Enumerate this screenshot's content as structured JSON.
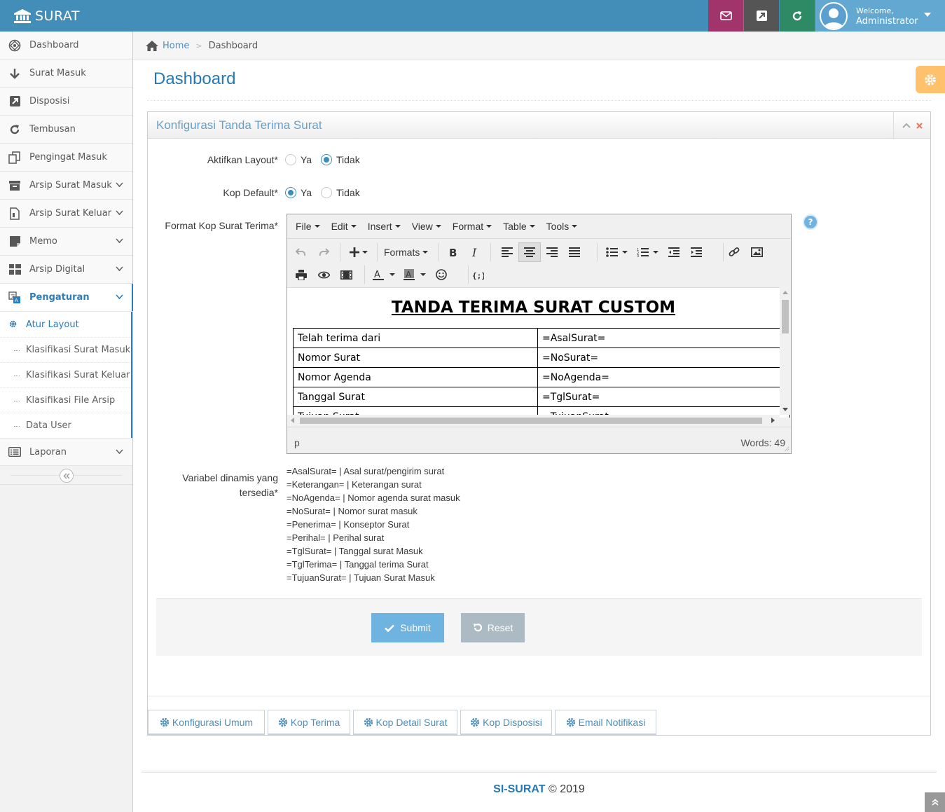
{
  "app": {
    "title": "SURAT"
  },
  "header": {
    "welcome_label": "Welcome,",
    "username": "Administrator",
    "colors": {
      "bar": "#438eb9",
      "mail": "#a0346b",
      "edit": "#555555",
      "refresh": "#2e8965",
      "user": "#62a8d1"
    }
  },
  "sidebar": {
    "items": [
      {
        "label": "Dashboard",
        "icon": "dashboard-icon"
      },
      {
        "label": "Surat Masuk",
        "icon": "arrow-down-icon"
      },
      {
        "label": "Disposisi",
        "icon": "share-icon"
      },
      {
        "label": "Tembusan",
        "icon": "refresh-icon"
      },
      {
        "label": "Pengingat Masuk",
        "icon": "copy-icon"
      },
      {
        "label": "Arsip Surat Masuk",
        "icon": "archive-icon"
      },
      {
        "label": "Arsip Surat Keluar",
        "icon": "file-icon"
      },
      {
        "label": "Memo",
        "icon": "sticky-note-icon"
      },
      {
        "label": "Arsip Digital",
        "icon": "grid-icon"
      },
      {
        "label": "Pengaturan",
        "icon": "language-icon"
      },
      {
        "label": "Laporan",
        "icon": "list-alt-icon"
      }
    ],
    "submenu": [
      {
        "label": "Atur Layout"
      },
      {
        "label": "Klasifikasi Surat Masuk"
      },
      {
        "label": "Klasifikasi Surat Keluar"
      },
      {
        "label": "Klasifikasi File Arsip"
      },
      {
        "label": "Data User"
      }
    ]
  },
  "breadcrumb": {
    "home": "Home",
    "current": "Dashboard"
  },
  "page": {
    "title": "Dashboard"
  },
  "widget": {
    "title": "Konfigurasi Tanda Terima Surat"
  },
  "form": {
    "aktifkan_layout": {
      "label": "Aktifkan Layout*",
      "opt_yes": "Ya",
      "opt_no": "Tidak",
      "selected": "Tidak"
    },
    "kop_default": {
      "label": "Kop Default*",
      "opt_yes": "Ya",
      "opt_no": "Tidak",
      "selected": "Ya"
    },
    "format_label": "Format Kop Surat Terima*",
    "variabel_label_1": "Variabel dinamis yang",
    "variabel_label_2": "tersedia*"
  },
  "editor": {
    "menus": [
      "File",
      "Edit",
      "Insert",
      "View",
      "Format",
      "Table",
      "Tools"
    ],
    "formats_label": "Formats",
    "doc_title": "TANDA TERIMA SURAT CUSTOM ",
    "rows": [
      [
        "Telah terima dari",
        "=AsalSurat="
      ],
      [
        "Nomor Surat",
        "=NoSurat="
      ],
      [
        "Nomor Agenda",
        "=NoAgenda="
      ],
      [
        "Tanggal Surat",
        "=TglSurat="
      ],
      [
        "Tujuan Surat",
        "=TujuanSurat="
      ]
    ],
    "path": "p",
    "word_count": "Words: 49"
  },
  "variables": [
    "=AsalSurat= | Asal surat/pengirim surat",
    "=Keterangan= | Keterangan surat",
    "=NoAgenda= | Nomor agenda surat masuk",
    "=NoSurat= | Nomor surat masuk",
    "=Penerima= | Konseptor Surat",
    "=Perihal= | Perihal surat",
    "=TglSurat= | Tanggal surat Masuk",
    "=TglTerima= | Tanggal terima Surat",
    "=TujuanSurat= | Tujuan Surat Masuk"
  ],
  "actions": {
    "submit": "Submit",
    "reset": "Reset"
  },
  "tabs": [
    "Konfigurasi Umum",
    "Kop Terima",
    "Kop Detail Surat",
    "Kop Disposisi",
    "Email Notifikasi"
  ],
  "footer": {
    "brand": "SI-SURAT",
    "copyright": "© 2019"
  }
}
